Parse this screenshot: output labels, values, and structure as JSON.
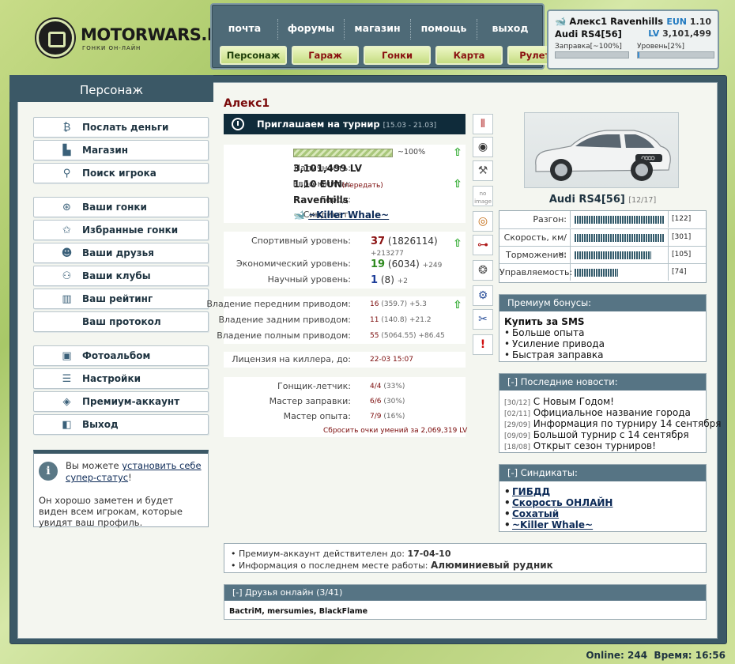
{
  "logo": {
    "title": "MOTORWARS.RU",
    "subtitle": "ГОНКИ ОН-ЛАЙН"
  },
  "topnav": {
    "links": [
      "почта",
      "форумы",
      "магазин",
      "помощь",
      "выход"
    ],
    "tabs": [
      "Персонаж",
      "Гараж",
      "Гонки",
      "Карта",
      "Рулетка"
    ]
  },
  "user": {
    "name": "Алекс1 Ravenhills",
    "car": "Audi RS4[56]",
    "eun_label": "EUN",
    "eun": "1.10",
    "lv_label": "LV",
    "lv": "3,101,499",
    "fuel_label": "Заправка[~100%]",
    "level_label": "Уровень[2%]",
    "fuel_pct": 100,
    "level_pct": 2
  },
  "left": {
    "heading": "Персонаж",
    "menu": [
      {
        "label": "Послать деньги",
        "icon": "money-icon",
        "glyph": "₿"
      },
      {
        "label": "Магазин",
        "icon": "shop-icon",
        "glyph": "▙"
      },
      {
        "label": "Поиск игрока",
        "icon": "search-icon",
        "glyph": "⚲"
      },
      {
        "label": "Ваши гонки",
        "icon": "steering-wheel-icon",
        "glyph": "⊛"
      },
      {
        "label": "Избранные гонки",
        "icon": "star-icon",
        "glyph": "✩"
      },
      {
        "label": "Ваши друзья",
        "icon": "friends-icon",
        "glyph": "☻"
      },
      {
        "label": "Ваши клубы",
        "icon": "clubs-icon",
        "glyph": "⚇"
      },
      {
        "label": "Ваш рейтинг",
        "icon": "rating-icon",
        "glyph": "▥"
      },
      {
        "label": "Ваш протокол",
        "icon": "",
        "glyph": ""
      },
      {
        "label": "Фотоальбом",
        "icon": "photo-icon",
        "glyph": "▣"
      },
      {
        "label": "Настройки",
        "icon": "settings-icon",
        "glyph": "☰"
      },
      {
        "label": "Премиум-аккаунт",
        "icon": "premium-icon",
        "glyph": "◈"
      },
      {
        "label": "Выход",
        "icon": "exit-icon",
        "glyph": "◧"
      }
    ],
    "info": {
      "pre": "Вы можете ",
      "link": "установить себе супер-статус",
      "post": "!",
      "text": "Он хорошо заметен и будет виден всем игрокам, которые увидят ваш профиль."
    }
  },
  "profile": {
    "name": "Алекс1",
    "tournament": {
      "title": "Приглашаем на турнир",
      "dates": "[15.03 - 21.03]"
    },
    "basic": {
      "fuel_label": "Заправка:",
      "fuel_value": "~100%",
      "fuel_pct": 100,
      "cash_label": "Наличность:",
      "cash": "3,101,499 LV",
      "euro_label": "Евро-юниты:",
      "euro": "1.10 EUN",
      "transfer": "(передать)",
      "city_label": "Город:",
      "city": "Ravenhills",
      "syndicate_label": "Синдикат:",
      "syndicate": "~Killer Whale~"
    },
    "levels": {
      "sport_label": "Спортивный уровень:",
      "sport": "37",
      "sport_exp": "(1826114)",
      "sport_next": "+213277",
      "econ_label": "Экономический уровень:",
      "econ": "19",
      "econ_exp": "(6034)",
      "econ_next": "+249",
      "sci_label": "Научный уровень:",
      "sci": "1",
      "sci_exp": "(8)",
      "sci_next": "+2"
    },
    "drives": [
      {
        "label": "Владение передним приводом:",
        "level": "16",
        "exp": "(359.7)",
        "plus": "+5.3"
      },
      {
        "label": "Владение задним приводом:",
        "level": "11",
        "exp": "(140.8)",
        "plus": "+21.2"
      },
      {
        "label": "Владение полным приводом:",
        "level": "55",
        "exp": "(5064.55)",
        "plus": "+86.45"
      }
    ],
    "license": {
      "label": "Лицензия на киллера, до:",
      "value": "22-03 15:07"
    },
    "skills": [
      {
        "label": "Гонщик-летчик:",
        "value": "4/4",
        "pct": "(33%)"
      },
      {
        "label": "Мастер заправки:",
        "value": "6/6",
        "pct": "(30%)"
      },
      {
        "label": "Мастер опыта:",
        "value": "7/9",
        "pct": "(16%)"
      }
    ],
    "reset": "Сбросить очки умений за 2,069,319 LV"
  },
  "side_icons": [
    "shocks-icon",
    "tire-icon",
    "wrench-icon",
    "no-image-icon",
    "brake-disc-icon",
    "exhaust-icon",
    "turbo-icon",
    "gearbox-icon",
    "mechanic-icon",
    "warning-icon"
  ],
  "car": {
    "name": "Audi RS4[56]",
    "count": "[12/17]",
    "params": [
      {
        "label": "Разгон:",
        "value": "[122]",
        "fill": 0.97
      },
      {
        "label": "Скорость, км/ч:",
        "value": "[301]",
        "fill": 0.97
      },
      {
        "label": "Торможение:",
        "value": "[105]",
        "fill": 0.82
      },
      {
        "label": "Управляемость:",
        "value": "[74]",
        "fill": 0.47
      }
    ]
  },
  "premium": {
    "title": "Премиум бонусы:",
    "buy": "Купить за SMS",
    "items": [
      "Больше опыта",
      "Усиление привода",
      "Быстрая заправка"
    ]
  },
  "news": {
    "title": "[-]  Последние новости:",
    "items": [
      {
        "date": "[30/12]",
        "text": "С Новым Годом!"
      },
      {
        "date": "[02/11]",
        "text": "Официальное название города"
      },
      {
        "date": "[29/09]",
        "text": "Информация по турниру 14 сентября"
      },
      {
        "date": "[09/09]",
        "text": "Большой турнир с 14 сентября"
      },
      {
        "date": "[18/08]",
        "text": "Открыт сезон турниров!"
      }
    ]
  },
  "syndicates": {
    "title": "[-]  Синдикаты:",
    "items": [
      "ГИБДД",
      "Скорость ОНЛАЙН",
      "Сохатый",
      "~Killer Whale~"
    ]
  },
  "status": {
    "premium_label": "Премиум-аккаунт действителен до:",
    "premium_date": "17-04-10",
    "work_label": "Информация о последнем месте работы:",
    "work": "Алюминиевый рудник"
  },
  "friends": {
    "title": "[-]  Друзья онлайн (3/41)",
    "list": "BactriM, mersumies, BlackFlame"
  },
  "footer": {
    "online_label": "Online:",
    "online": "244",
    "time_label": "Время:",
    "time": "16:56"
  },
  "colors": {
    "accent": "#3b5866",
    "dark": "#0f2b3a",
    "name_red": "#7a0a0a",
    "up_arrow": "#2aa82a"
  }
}
